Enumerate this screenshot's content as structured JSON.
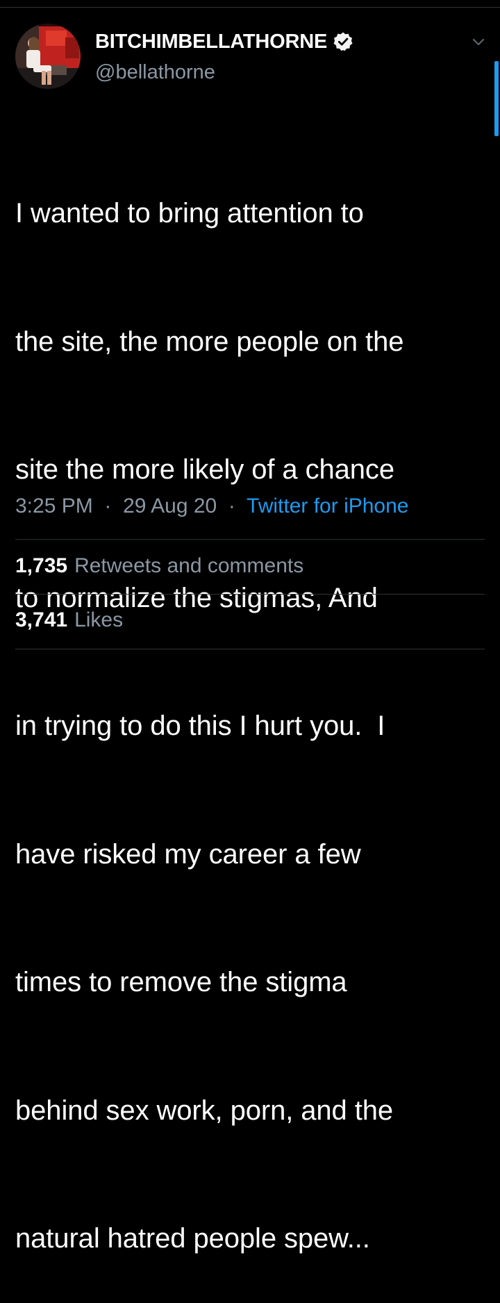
{
  "tweet": {
    "author": {
      "display_name": "BITCHIMBELLATHORNE",
      "handle": "@bellathorne",
      "verified": true,
      "avatar_icon": "profile-photo-avatar"
    },
    "text_lines": [
      "I wanted to bring attention to",
      "the site, the more people on the",
      "site the more likely of a chance",
      "to normalize the stigmas, And",
      "in trying to do this I hurt you.  I",
      "have risked my career a few",
      "times to remove the stigma",
      "behind sex work, porn, and the",
      "natural hatred people spew..."
    ],
    "time": "3:25 PM",
    "date": "29 Aug 20",
    "separator": "·",
    "source": "Twitter for iPhone",
    "stats": {
      "retweets": {
        "count": "1,735",
        "label": "Retweets and comments"
      },
      "likes": {
        "count": "3,741",
        "label": "Likes"
      }
    }
  },
  "colors": {
    "background": "#000000",
    "text_primary": "#ffffff",
    "text_secondary": "#8b98a5",
    "link": "#1d9bf0",
    "divider": "#2f3336"
  },
  "icons": {
    "verified": "verified-badge-icon",
    "menu": "chevron-down-icon"
  }
}
